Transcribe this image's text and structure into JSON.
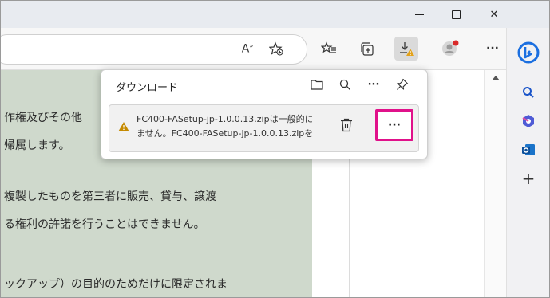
{
  "window": {
    "minimize_label": "–",
    "maximize_label": "",
    "close_label": "✕"
  },
  "toolbar": {
    "read_aloud_label": "A",
    "read_aloud_sup": "»",
    "more_label": "···"
  },
  "doc": {
    "lines": [
      "作権及びその他",
      "帰属します。",
      "複製したものを第三者に販売、貸与、譲渡",
      "る権利の許諾を行うことはできません。",
      "ックアップ）の目的のためだけに限定されま"
    ]
  },
  "downloads": {
    "title": "ダウンロード",
    "item": {
      "line1": "FC400-FASetup-jp-1.0.0.13.zipは一般的に",
      "line2": "ません。FC400-FASetup-jp-1.0.0.13.zipを",
      "more_label": "···"
    },
    "more_label": "···"
  },
  "sidebar": {
    "add_label": "+"
  },
  "colors": {
    "highlight": "#e0118a",
    "warning": "#c58a00",
    "doc_bg": "#cfd9cc"
  }
}
